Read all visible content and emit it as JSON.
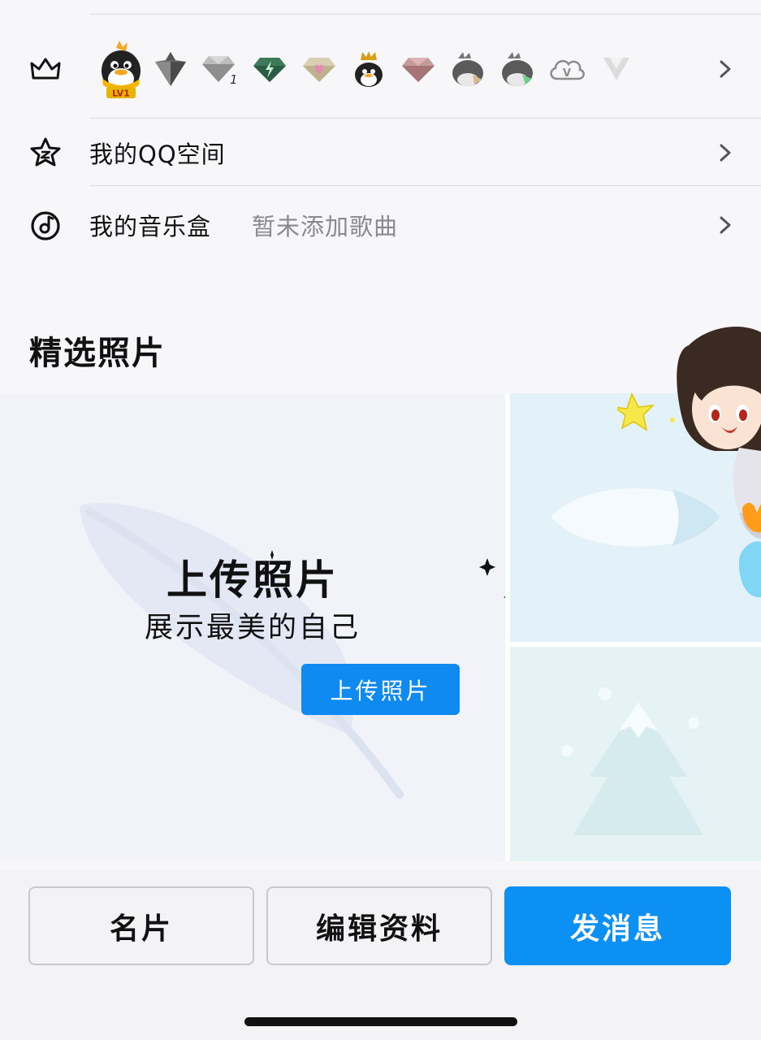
{
  "badges_row": {
    "icons": [
      "qq-level-lv1-icon",
      "diamond-gray-icon",
      "diamond-silver-1-icon",
      "diamond-green-bolt-icon",
      "diamond-heart-icon",
      "crowned-penguin-icon",
      "diamond-pink-icon",
      "penguin-gray-icon",
      "penguin-green-icon",
      "cloud-v-icon",
      "v-chevron-icon"
    ],
    "level_text": "LV1",
    "diamond_number": "1",
    "cloud_letter": "V"
  },
  "qzone": {
    "label": "我的QQ空间"
  },
  "music": {
    "label": "我的音乐盒",
    "status": "暂未添加歌曲"
  },
  "featured": {
    "title": "精选照片",
    "upload_title": "上传照片",
    "upload_sub": "展示最美的自己",
    "upload_button": "上传照片"
  },
  "actions": {
    "card": "名片",
    "edit": "编辑资料",
    "message": "发消息"
  },
  "colors": {
    "accent": "#0d90f3",
    "text": "#111111",
    "muted": "#8a8a8e"
  }
}
